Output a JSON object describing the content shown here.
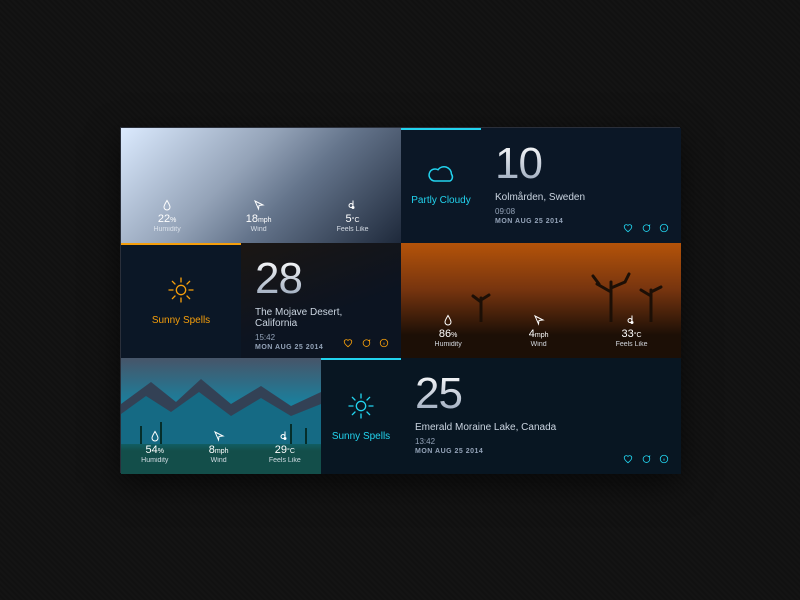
{
  "labels": {
    "humidity": "Humidity",
    "wind": "Wind",
    "feels": "Feels Like"
  },
  "units": {
    "percent": "%",
    "mph": "mph",
    "degC": "°C"
  },
  "cards": [
    {
      "condition": "Partly Cloudy",
      "temp": "10",
      "location": "Kolmården, Sweden",
      "time": "09:08",
      "date": "MON AUG 25 2014",
      "humidity": "22",
      "wind": "18",
      "feels": "5",
      "accent": "cyan"
    },
    {
      "condition": "Sunny Spells",
      "temp": "28",
      "location": "The Mojave Desert, California",
      "time": "15:42",
      "date": "MON AUG 25 2014",
      "humidity": "86",
      "wind": "4",
      "feels": "33",
      "accent": "orange"
    },
    {
      "condition": "Sunny Spells",
      "temp": "25",
      "location": "Emerald Moraine Lake, Canada",
      "time": "13:42",
      "date": "MON AUG 25 2014",
      "humidity": "54",
      "wind": "8",
      "feels": "29",
      "accent": "cyan"
    }
  ]
}
